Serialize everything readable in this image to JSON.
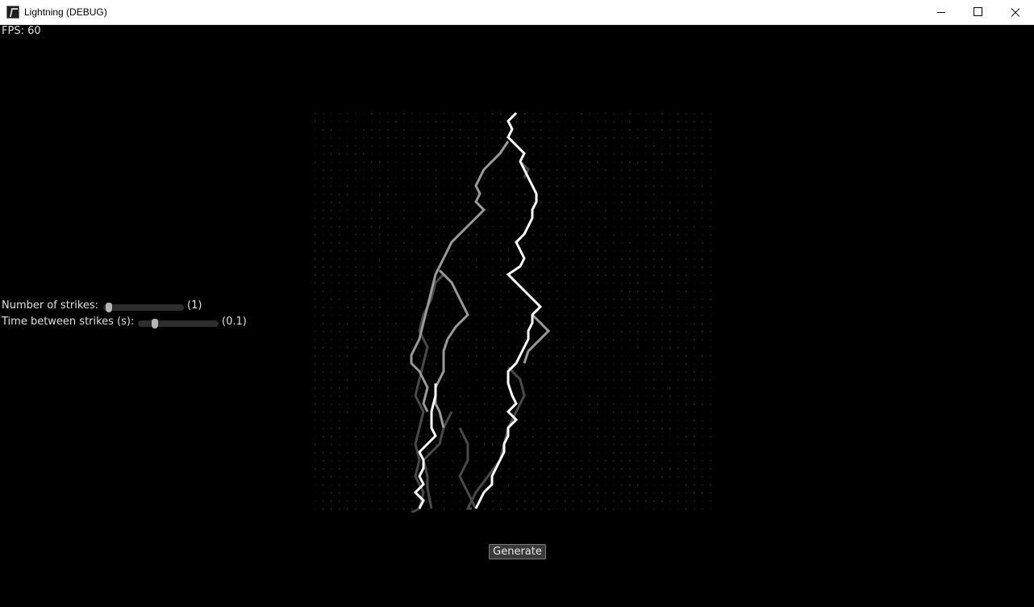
{
  "window": {
    "title": "Lightning (DEBUG)",
    "icon": "app-icon",
    "controls": [
      "minimize-icon",
      "maximize-icon",
      "close-icon"
    ]
  },
  "overlay": {
    "fps_text": "FPS: 60"
  },
  "controls": {
    "strikes": {
      "label": "Number of strikes:",
      "value_text": "(1)",
      "level": 0.0
    },
    "time": {
      "label": "Time between strikes (s):",
      "value_text": "(0.1)",
      "level": 0.1
    }
  },
  "generate": {
    "label": "Generate"
  },
  "colors": {
    "background": "#000000",
    "bolt_main": "#ffffff",
    "bolt_mid": "#9a9a9a",
    "bolt_dim": "#4a4a4a",
    "grid_dot": "#3a3a3a"
  }
}
